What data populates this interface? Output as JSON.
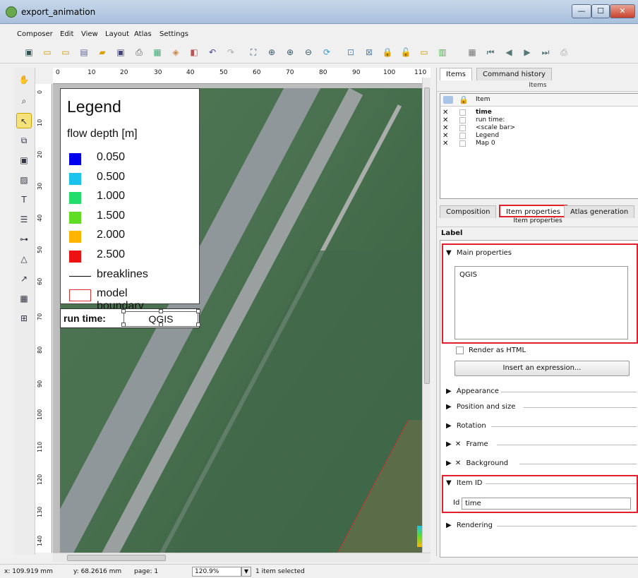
{
  "window": {
    "title": "export_animation",
    "min": "—",
    "max": "☐",
    "close": "✕"
  },
  "menu": [
    "Composer",
    "Edit",
    "View",
    "Layout",
    "Atlas",
    "Settings"
  ],
  "ruler": {
    "h": [
      "0",
      "10",
      "20",
      "30",
      "40",
      "50",
      "60",
      "70",
      "80",
      "90",
      "100",
      "110"
    ],
    "v": [
      "0",
      "10",
      "20",
      "30",
      "40",
      "50",
      "60",
      "70",
      "80",
      "90",
      "100",
      "110",
      "120",
      "130",
      "140"
    ]
  },
  "legend": {
    "title": "Legend",
    "subtitle": "flow depth [m]",
    "entries": [
      {
        "label": "0.050",
        "color": "#0000ee"
      },
      {
        "label": "0.500",
        "color": "#19c3ee"
      },
      {
        "label": "1.000",
        "color": "#22dd6a"
      },
      {
        "label": "1.500",
        "color": "#5fdd22"
      },
      {
        "label": "2.000",
        "color": "#ffb400"
      },
      {
        "label": "2.500",
        "color": "#ee1111"
      }
    ],
    "breaklines": "breaklines",
    "boundary": "model boundary"
  },
  "label_item": {
    "runtime": "run time:",
    "text": "QGIS"
  },
  "panel": {
    "tabs_top": [
      "Items",
      "Command history"
    ],
    "items_title": "Items",
    "items_col": "Item",
    "items": [
      "time",
      "run time:",
      "<scale bar>",
      "Legend",
      "Map 0"
    ],
    "tabs_bottom": [
      "Composition",
      "Item properties",
      "Atlas generation"
    ],
    "props_title": "Item properties",
    "section": "Label",
    "main_properties": "Main properties",
    "text": "QGIS",
    "render_html": "Render as HTML",
    "insert_expr": "Insert an expression...",
    "groups": [
      "Appearance",
      "Position and size",
      "Rotation",
      "Frame",
      "Background"
    ],
    "item_id_group": "Item ID",
    "id_label": "Id",
    "id_value": "time",
    "rendering": "Rendering"
  },
  "status": {
    "x": "x: 109.919 mm",
    "y": "y: 68.2616 mm",
    "page": "page: 1",
    "zoom": "120.9%",
    "selected": "1 item selected"
  },
  "colors": {
    "accent_red": "#e0202a"
  }
}
